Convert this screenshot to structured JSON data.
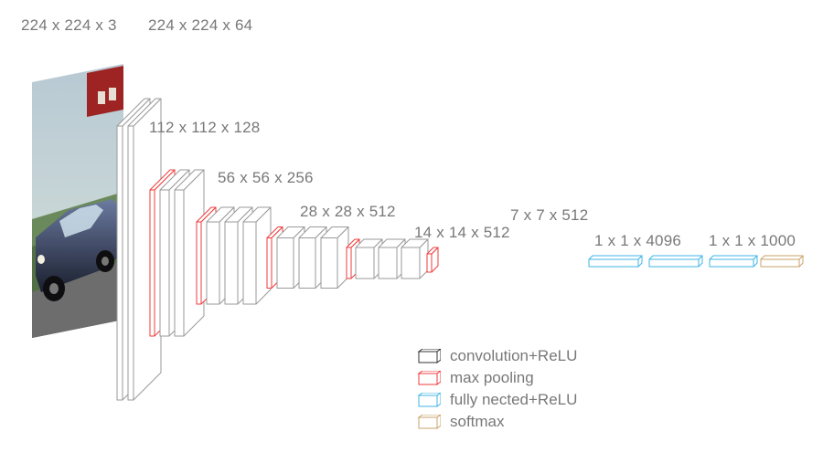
{
  "labels": {
    "input": "224 x 224 x 3",
    "b1": "224 x 224 x 64",
    "b2": "112 x 112 x 128",
    "b3": "56 x 56 x 256",
    "b4": "28 x 28 x 512",
    "b5": "14 x 14 x 512",
    "b6": "7 x 7 x 512",
    "fc": "1 x 1 x 4096",
    "out": "1 x 1 x 1000"
  },
  "legend": {
    "conv": "convolution+ReLU",
    "pool": "max pooling",
    "fc": "fully nected+ReLU",
    "soft": "softmax"
  },
  "colors": {
    "line_dark": "#9a9a9a",
    "line_black": "#333333",
    "red": "#ef3b3b",
    "cyan": "#3fb5e6",
    "tan": "#c9a36a",
    "fill": "#ffffff"
  },
  "chart_data": {
    "type": "diagram",
    "title": "VGG-16 architecture",
    "input_shape": [
      224,
      224,
      3
    ],
    "blocks": [
      {
        "name": "conv1",
        "type": "conv",
        "count": 2,
        "out_shape": [
          224,
          224,
          64
        ]
      },
      {
        "name": "pool1",
        "type": "pool",
        "count": 1,
        "out_shape": [
          112,
          112,
          64
        ]
      },
      {
        "name": "conv2",
        "type": "conv",
        "count": 2,
        "out_shape": [
          112,
          112,
          128
        ]
      },
      {
        "name": "pool2",
        "type": "pool",
        "count": 1,
        "out_shape": [
          56,
          56,
          128
        ]
      },
      {
        "name": "conv3",
        "type": "conv",
        "count": 3,
        "out_shape": [
          56,
          56,
          256
        ]
      },
      {
        "name": "pool3",
        "type": "pool",
        "count": 1,
        "out_shape": [
          28,
          28,
          256
        ]
      },
      {
        "name": "conv4",
        "type": "conv",
        "count": 3,
        "out_shape": [
          28,
          28,
          512
        ]
      },
      {
        "name": "pool4",
        "type": "pool",
        "count": 1,
        "out_shape": [
          14,
          14,
          512
        ]
      },
      {
        "name": "conv5",
        "type": "conv",
        "count": 3,
        "out_shape": [
          14,
          14,
          512
        ]
      },
      {
        "name": "pool5",
        "type": "pool",
        "count": 1,
        "out_shape": [
          7,
          7,
          512
        ]
      },
      {
        "name": "fc6",
        "type": "fc",
        "count": 1,
        "out_shape": [
          1,
          1,
          4096
        ]
      },
      {
        "name": "fc7",
        "type": "fc",
        "count": 1,
        "out_shape": [
          1,
          1,
          4096
        ]
      },
      {
        "name": "fc8",
        "type": "softmax",
        "count": 1,
        "out_shape": [
          1,
          1,
          1000
        ]
      }
    ]
  }
}
